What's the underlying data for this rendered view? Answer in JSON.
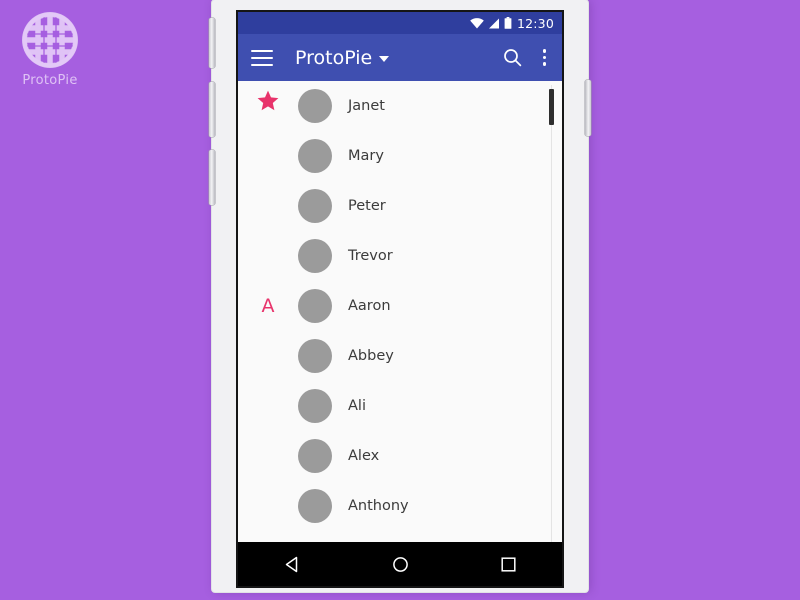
{
  "watermark": {
    "logo_icon": "protopie-lattice-logo",
    "label": "ProtoPie"
  },
  "colors": {
    "background_purple": "#a65fe0",
    "app_bar_blue": "#3f4fb0",
    "status_bar_blue": "#2f3e9e",
    "accent_pink": "#e8336b",
    "avatar_gray": "#9b9b9b",
    "screen_background": "#fafafa",
    "nav_bar_black": "#000000"
  },
  "device": {
    "side_buttons": [
      {
        "name": "volume-up-button"
      },
      {
        "name": "volume-down-button"
      },
      {
        "name": "mute-button"
      },
      {
        "name": "power-button"
      }
    ]
  },
  "status_bar": {
    "time": "12:30",
    "icons": [
      "wifi-icon",
      "signal-icon",
      "battery-icon"
    ]
  },
  "app_bar": {
    "menu_icon": "hamburger-menu-icon",
    "title": "ProtoPie",
    "title_caret_icon": "chevron-down-icon",
    "search_icon": "search-icon",
    "overflow_icon": "overflow-menu-icon"
  },
  "contact_list": {
    "sections": [
      {
        "header_type": "star",
        "header_label": "★",
        "header_icon": "star-icon",
        "contacts": [
          {
            "name": "Janet",
            "avatar": "avatar-placeholder"
          },
          {
            "name": "Mary",
            "avatar": "avatar-placeholder"
          },
          {
            "name": "Peter",
            "avatar": "avatar-placeholder"
          },
          {
            "name": "Trevor",
            "avatar": "avatar-placeholder"
          }
        ]
      },
      {
        "header_type": "letter",
        "header_label": "A",
        "header_icon": "",
        "contacts": [
          {
            "name": "Aaron",
            "avatar": "avatar-placeholder"
          },
          {
            "name": "Abbey",
            "avatar": "avatar-placeholder"
          },
          {
            "name": "Ali",
            "avatar": "avatar-placeholder"
          },
          {
            "name": "Alex",
            "avatar": "avatar-placeholder"
          },
          {
            "name": "Anthony",
            "avatar": "avatar-placeholder"
          }
        ]
      }
    ],
    "scrollbar": {
      "position": "top"
    }
  },
  "nav_bar": {
    "buttons": [
      {
        "name": "back-button",
        "icon": "triangle-back-icon"
      },
      {
        "name": "home-button",
        "icon": "circle-home-icon"
      },
      {
        "name": "recents-button",
        "icon": "square-recents-icon"
      }
    ]
  }
}
